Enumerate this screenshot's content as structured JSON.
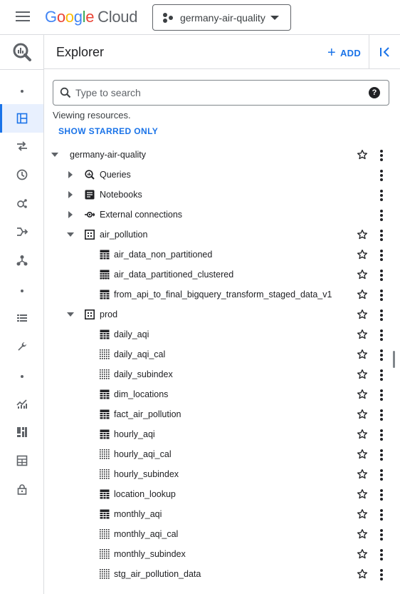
{
  "header": {
    "logo_letters": [
      "G",
      "o",
      "o",
      "g",
      "l",
      "e"
    ],
    "logo_suffix": "Cloud",
    "project_name": "germany-air-quality"
  },
  "rail": {
    "items": [
      {
        "icon": "bigquery-icon"
      },
      {
        "icon": "dot-icon"
      },
      {
        "icon": "explorer-icon",
        "active": true
      },
      {
        "icon": "transfer-icon"
      },
      {
        "icon": "history-icon"
      },
      {
        "icon": "analytics-hub-icon"
      },
      {
        "icon": "dataflow-icon"
      },
      {
        "icon": "workflow-icon"
      },
      {
        "icon": "dot-icon"
      },
      {
        "icon": "list-icon"
      },
      {
        "icon": "wrench-icon"
      },
      {
        "icon": "dot-icon"
      },
      {
        "icon": "monitoring-icon"
      },
      {
        "icon": "dashboard-icon"
      },
      {
        "icon": "table-admin-icon"
      },
      {
        "icon": "lock-icon"
      }
    ]
  },
  "explorer": {
    "title": "Explorer",
    "add_label": "ADD",
    "search_placeholder": "Type to search",
    "help_glyph": "?",
    "viewing_text": "Viewing resources.",
    "starred_label": "SHOW STARRED ONLY"
  },
  "tree": [
    {
      "label": "germany-air-quality",
      "level": 0,
      "expander": "down",
      "icon": "none",
      "star": true
    },
    {
      "label": "Queries",
      "level": 1,
      "expander": "right",
      "icon": "query-icon",
      "star": false
    },
    {
      "label": "Notebooks",
      "level": 1,
      "expander": "right",
      "icon": "notebook-icon",
      "star": false
    },
    {
      "label": "External connections",
      "level": 1,
      "expander": "right",
      "icon": "connection-icon",
      "star": false
    },
    {
      "label": "air_pollution",
      "level": 1,
      "expander": "down",
      "icon": "dataset-icon",
      "star": true
    },
    {
      "label": "air_data_non_partitioned",
      "level": 2,
      "expander": "none",
      "icon": "table-icon",
      "star": true
    },
    {
      "label": "air_data_partitioned_clustered",
      "level": 2,
      "expander": "none",
      "icon": "partitioned-table-icon",
      "star": true
    },
    {
      "label": "from_api_to_final_bigquery_transform_staged_data_v1",
      "level": 2,
      "expander": "none",
      "icon": "table-icon",
      "star": true
    },
    {
      "label": "prod",
      "level": 1,
      "expander": "down",
      "icon": "dataset-icon",
      "star": true
    },
    {
      "label": "daily_aqi",
      "level": 2,
      "expander": "none",
      "icon": "table-icon",
      "star": true
    },
    {
      "label": "daily_aqi_cal",
      "level": 2,
      "expander": "none",
      "icon": "view-icon",
      "star": true
    },
    {
      "label": "daily_subindex",
      "level": 2,
      "expander": "none",
      "icon": "view-icon",
      "star": true
    },
    {
      "label": "dim_locations",
      "level": 2,
      "expander": "none",
      "icon": "table-icon",
      "star": true
    },
    {
      "label": "fact_air_pollution",
      "level": 2,
      "expander": "none",
      "icon": "table-icon",
      "star": true
    },
    {
      "label": "hourly_aqi",
      "level": 2,
      "expander": "none",
      "icon": "table-icon",
      "star": true
    },
    {
      "label": "hourly_aqi_cal",
      "level": 2,
      "expander": "none",
      "icon": "view-icon",
      "star": true
    },
    {
      "label": "hourly_subindex",
      "level": 2,
      "expander": "none",
      "icon": "view-icon",
      "star": true
    },
    {
      "label": "location_lookup",
      "level": 2,
      "expander": "none",
      "icon": "table-icon",
      "star": true
    },
    {
      "label": "monthly_aqi",
      "level": 2,
      "expander": "none",
      "icon": "table-icon",
      "star": true
    },
    {
      "label": "monthly_aqi_cal",
      "level": 2,
      "expander": "none",
      "icon": "view-icon",
      "star": true
    },
    {
      "label": "monthly_subindex",
      "level": 2,
      "expander": "none",
      "icon": "view-icon",
      "star": true
    },
    {
      "label": "stg_air_pollution_data",
      "level": 2,
      "expander": "none",
      "icon": "view-icon",
      "star": true
    }
  ],
  "colors": {
    "accent": "#1a73e8",
    "text": "#202124",
    "icon": "#5f6368"
  }
}
